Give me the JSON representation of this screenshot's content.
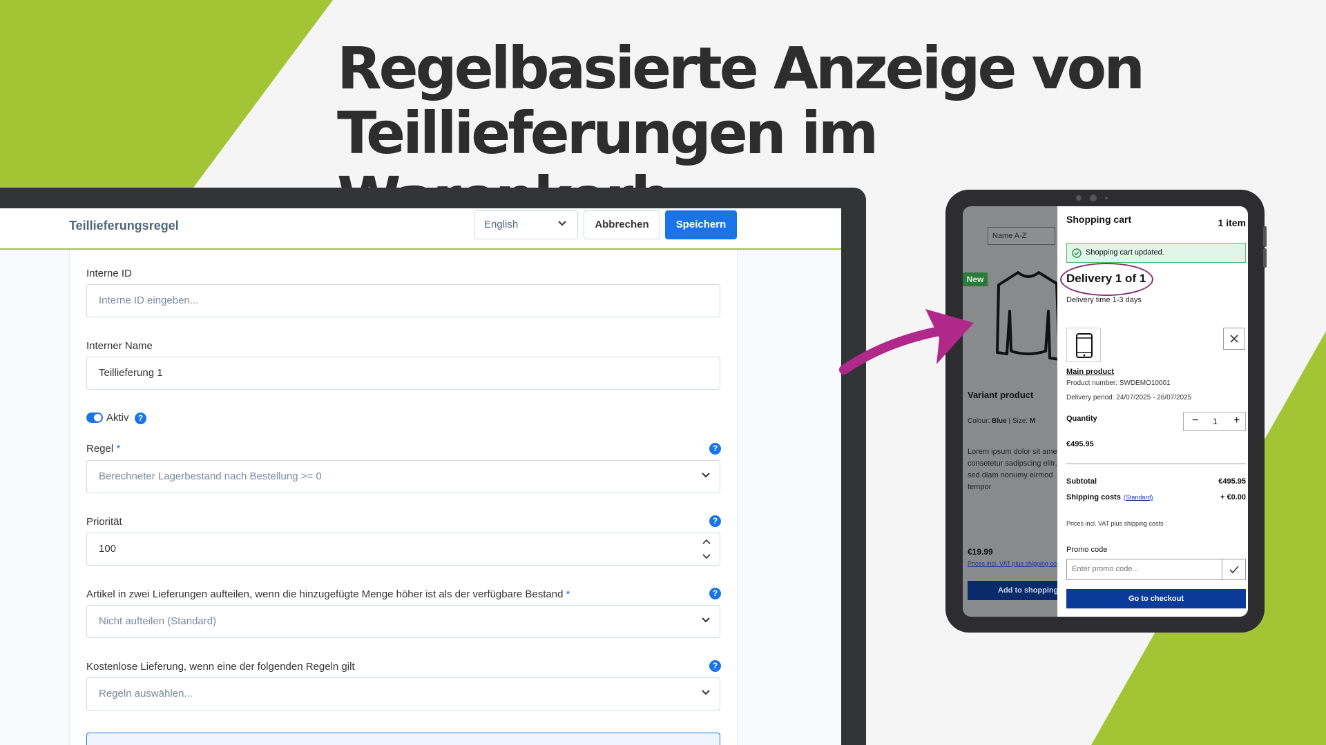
{
  "headline": {
    "line1": "Regelbasierte Anzeige von",
    "line2": "Teillieferungen im Warenkorb"
  },
  "colors": {
    "accent_green": "#a3c535",
    "primary_blue": "#1a73e8",
    "annotation_magenta": "#b0288a"
  },
  "admin": {
    "title": "Teillieferungsregel",
    "language": "English",
    "cancel_label": "Abbrechen",
    "save_label": "Speichern",
    "fields": {
      "internal_id_label": "Interne ID",
      "internal_id_placeholder": "Interne ID eingeben...",
      "internal_name_label": "Interner Name",
      "internal_name_value": "Teillieferung 1",
      "active_label": "Aktiv",
      "rule_label": "Regel",
      "rule_value": "Berechneter Lagerbestand nach Bestellung >= 0",
      "priority_label": "Priorität",
      "priority_value": "100",
      "split_label": "Artikel in zwei Lieferungen aufteilen, wenn die hinzugefügte Menge höher ist als der verfügbare Bestand",
      "split_value": "Nicht aufteilen (Standard)",
      "free_delivery_label": "Kostenlose Lieferung, wenn eine der folgenden Regeln gilt",
      "free_delivery_placeholder": "Regeln auswählen..."
    },
    "required_mark": "*",
    "help_glyph": "?"
  },
  "shop": {
    "sort_value": "Name A-Z",
    "new_badge": "New",
    "variant_title": "Variant product",
    "colour_label": "Colour:",
    "colour_value": "Blue",
    "size_label": "Size:",
    "size_value": "M",
    "lorem": "Lorem ipsum dolor sit amet, consetetur sadipscing elitr, sed diam nonumy eirmod tempor",
    "price": "€19.99",
    "vat_link": "Prices incl. VAT plus shipping costs",
    "add_to_cart": "Add to shopping cart"
  },
  "cart": {
    "title": "Shopping cart",
    "count": "1 item",
    "alert": "Shopping cart updated.",
    "delivery_title": "Delivery 1 of 1",
    "delivery_time": "Delivery time 1-3 days",
    "product_name": "Main product",
    "product_number": "Product number: SWDEMO10001",
    "delivery_period": "Delivery period: 24/07/2025 - 26/07/2025",
    "quantity_label": "Quantity",
    "quantity_value": "1",
    "line_price": "€495.95",
    "subtotal_label": "Subtotal",
    "subtotal_value": "€495.95",
    "shipping_label": "Shipping costs",
    "shipping_link": "(Standard)",
    "shipping_value": "+ €0.00",
    "vat_note": "Prices incl. VAT plus shipping costs",
    "promo_label": "Promo code",
    "promo_placeholder": "Enter promo code...",
    "checkout_label": "Go to checkout"
  }
}
